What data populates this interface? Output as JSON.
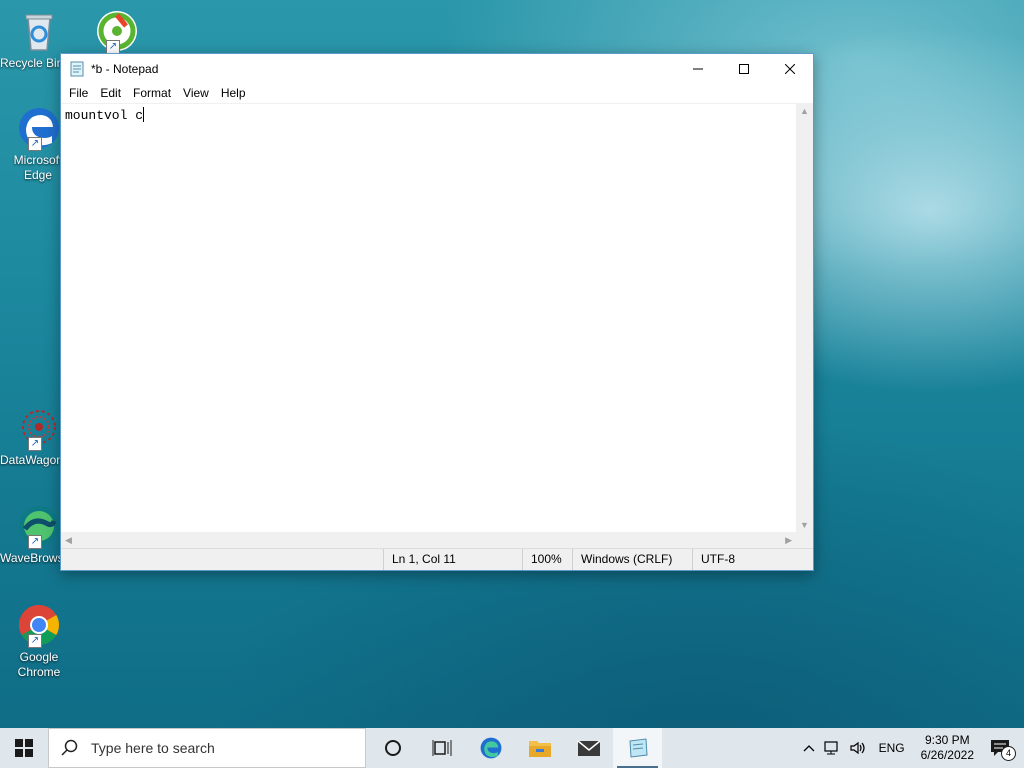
{
  "desktop": {
    "icons": [
      {
        "label": "Recycle Bin",
        "icon": "recycle-bin-icon"
      },
      {
        "label": "",
        "icon": "app-shortcut-icon"
      },
      {
        "label": "Microsoft Edge",
        "icon": "edge-icon"
      },
      {
        "label": "DataWagon",
        "icon": "datawagon-icon"
      },
      {
        "label": "WaveBrowser",
        "icon": "wavebrowser-icon"
      },
      {
        "label": "Google Chrome",
        "icon": "chrome-icon"
      }
    ]
  },
  "notepad": {
    "title": "*b - Notepad",
    "menu": [
      "File",
      "Edit",
      "Format",
      "View",
      "Help"
    ],
    "content": "mountvol c",
    "status": {
      "position": "Ln 1, Col 11",
      "zoom": "100%",
      "line_ending": "Windows (CRLF)",
      "encoding": "UTF-8"
    }
  },
  "taskbar": {
    "search_placeholder": "Type here to search",
    "pinned": [
      "cortana-icon",
      "task-view-icon",
      "edge-icon",
      "file-explorer-icon",
      "mail-icon",
      "notepad-icon"
    ],
    "tray": {
      "language": "ENG",
      "time": "9:30 PM",
      "date": "6/26/2022",
      "notification_count": "4"
    }
  }
}
